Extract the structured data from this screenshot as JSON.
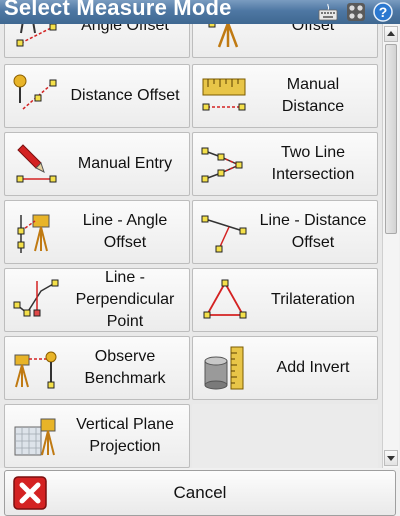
{
  "window": {
    "title": "Select Measure Mode"
  },
  "titlebar_icons": [
    "keyboard-icon",
    "grid-menu-icon",
    "help-icon"
  ],
  "modes": [
    {
      "label": "Angle Offset",
      "icon": "angle-offset-icon"
    },
    {
      "label": "Offset",
      "icon": "instrument-offset-icon"
    },
    {
      "label": "Distance Offset",
      "icon": "distance-offset-icon"
    },
    {
      "label": "Manual\nDistance",
      "icon": "tape-measure-icon"
    },
    {
      "label": "Manual Entry",
      "icon": "pencil-entry-icon"
    },
    {
      "label": "Two Line\nIntersection",
      "icon": "two-line-intersection-icon"
    },
    {
      "label": "Line - Angle\nOffset",
      "icon": "line-angle-offset-icon"
    },
    {
      "label": "Line - Distance\nOffset",
      "icon": "line-distance-offset-icon"
    },
    {
      "label": "Line -\nPerpendicular\nPoint",
      "icon": "perpendicular-point-icon"
    },
    {
      "label": "Trilateration",
      "icon": "trilateration-icon"
    },
    {
      "label": "Observe\nBenchmark",
      "icon": "observe-benchmark-icon"
    },
    {
      "label": "Add Invert",
      "icon": "pipe-invert-icon"
    },
    {
      "label": "Vertical Plane\nProjection",
      "icon": "vertical-plane-icon"
    }
  ],
  "cancel": {
    "label": "Cancel"
  },
  "colors": {
    "titlebar": "#4e77a3",
    "accent_red": "#d42222",
    "instrument_yellow": "#e8b428"
  }
}
